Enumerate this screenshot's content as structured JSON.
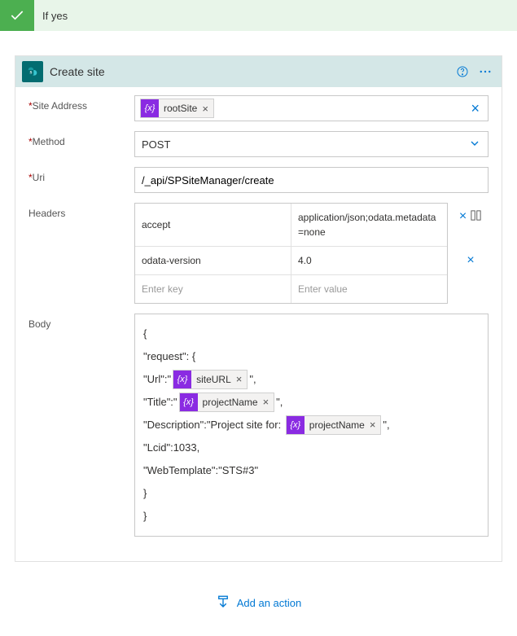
{
  "condition": {
    "label": "If yes"
  },
  "action": {
    "title": "Create site",
    "fields": {
      "site_address_label": "Site Address",
      "method_label": "Method",
      "uri_label": "Uri",
      "headers_label": "Headers",
      "body_label": "Body"
    },
    "site_address_token": "rootSite",
    "method_value": "POST",
    "uri_value": "/_api/SPSiteManager/create",
    "headers": [
      {
        "key": "accept",
        "value": "application/json;odata.metadata=none"
      },
      {
        "key": "odata-version",
        "value": "4.0"
      }
    ],
    "headers_placeholder_key": "Enter key",
    "headers_placeholder_value": "Enter value",
    "body": {
      "line1": "{",
      "line2": "\"request\": {",
      "url_prefix": "\"Url\":\"",
      "url_token": "siteURL",
      "url_suffix": "\",",
      "title_prefix": "\"Title\":\"",
      "title_token": "projectName",
      "title_suffix": "\",",
      "desc_prefix": "\"Description\":\"Project site for: ",
      "desc_token": "projectName",
      "desc_suffix": "\",",
      "lcid": "\"Lcid\":1033,",
      "webtemplate": "\"WebTemplate\":\"STS#3\"",
      "close1": "}",
      "close2": "}"
    }
  },
  "add_action_label": "Add an action"
}
